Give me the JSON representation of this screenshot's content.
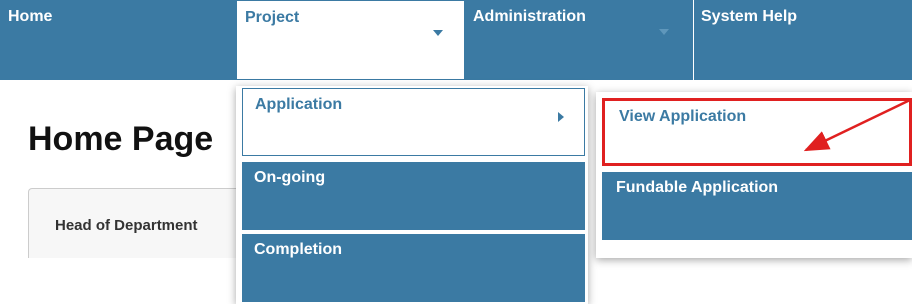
{
  "nav": {
    "home": "Home",
    "project": "Project",
    "administration": "Administration",
    "system_help": "System Help"
  },
  "page": {
    "title": "Home Page",
    "tab_label": "Head of Department"
  },
  "project_menu": {
    "items": [
      "Application",
      "On-going",
      "Completion"
    ]
  },
  "application_submenu": {
    "items": [
      "View Application",
      "Fundable Application"
    ]
  },
  "colors": {
    "nav_blue": "#3b7aa3",
    "highlight_red": "#e02020"
  }
}
